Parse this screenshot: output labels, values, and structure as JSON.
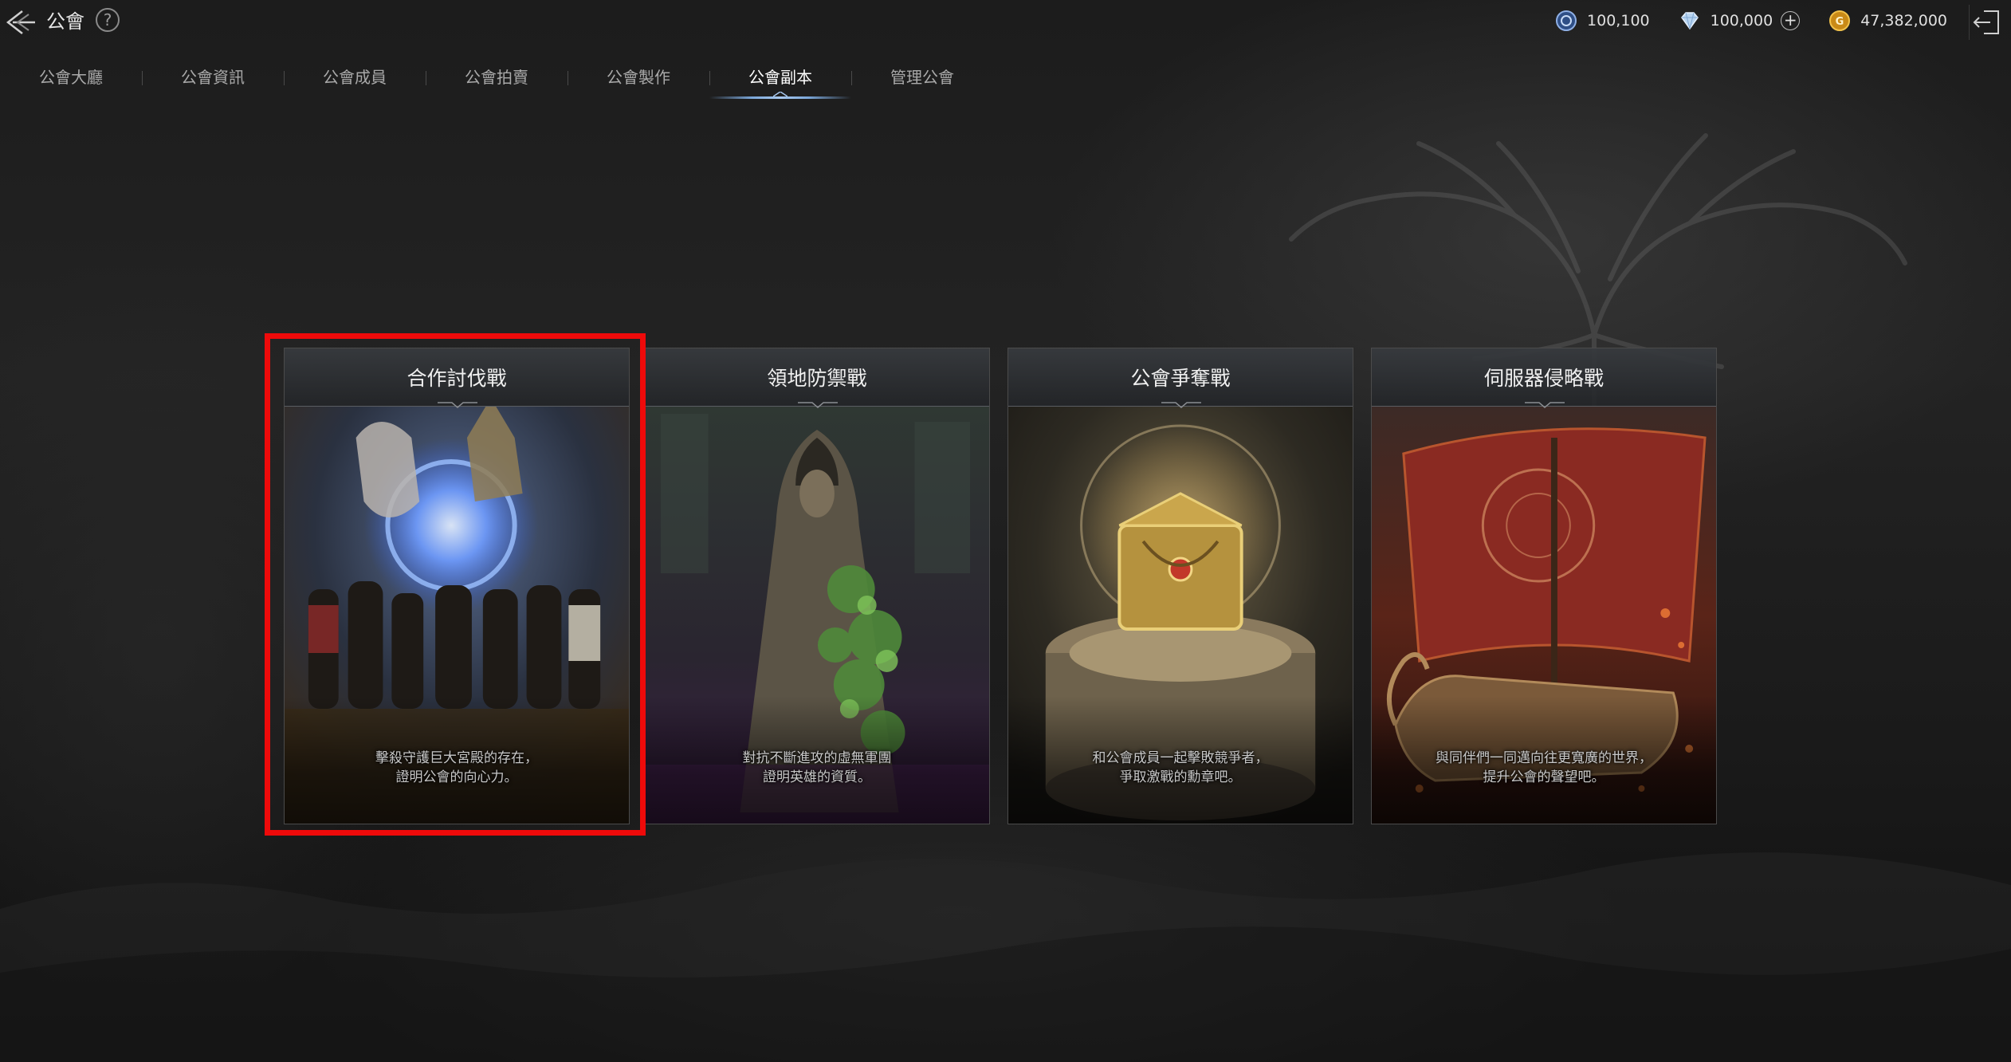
{
  "header": {
    "title": "公會",
    "help_label": "?"
  },
  "currencies": [
    {
      "icon": "blue-coin-icon",
      "value": "100,100"
    },
    {
      "icon": "diamond-icon",
      "value": "100,000",
      "plus": "+"
    },
    {
      "icon": "gold-coin-icon",
      "value": "47,382,000"
    }
  ],
  "tabs": [
    {
      "label": "公會大廳"
    },
    {
      "label": "公會資訊"
    },
    {
      "label": "公會成員"
    },
    {
      "label": "公會拍賣"
    },
    {
      "label": "公會製作"
    },
    {
      "label": "公會副本",
      "active": true
    },
    {
      "label": "管理公會"
    }
  ],
  "cards": [
    {
      "title": "合作討伐戰",
      "desc_line1": "擊殺守護巨大宮殿的存在，",
      "desc_line2": "證明公會的向心力。",
      "theme": "#3a5b9a"
    },
    {
      "title": "領地防禦戰",
      "desc_line1": "對抗不斷進攻的虛無軍團",
      "desc_line2": "證明英雄的資質。",
      "theme": "#4a2d5a"
    },
    {
      "title": "公會爭奪戰",
      "desc_line1": "和公會成員一起擊敗競爭者，",
      "desc_line2": "爭取激戰的勳章吧。",
      "theme": "#7a5a2a"
    },
    {
      "title": "伺服器侵略戰",
      "desc_line1": "與同伴們一同邁向往更寬廣的世界，",
      "desc_line2": "提升公會的聲望吧。",
      "theme": "#7a2a1e"
    }
  ],
  "colors": {
    "highlight": "#ee0a0a",
    "active_tab_underline": "#7aa6d8",
    "gold": "#d9a93a"
  }
}
